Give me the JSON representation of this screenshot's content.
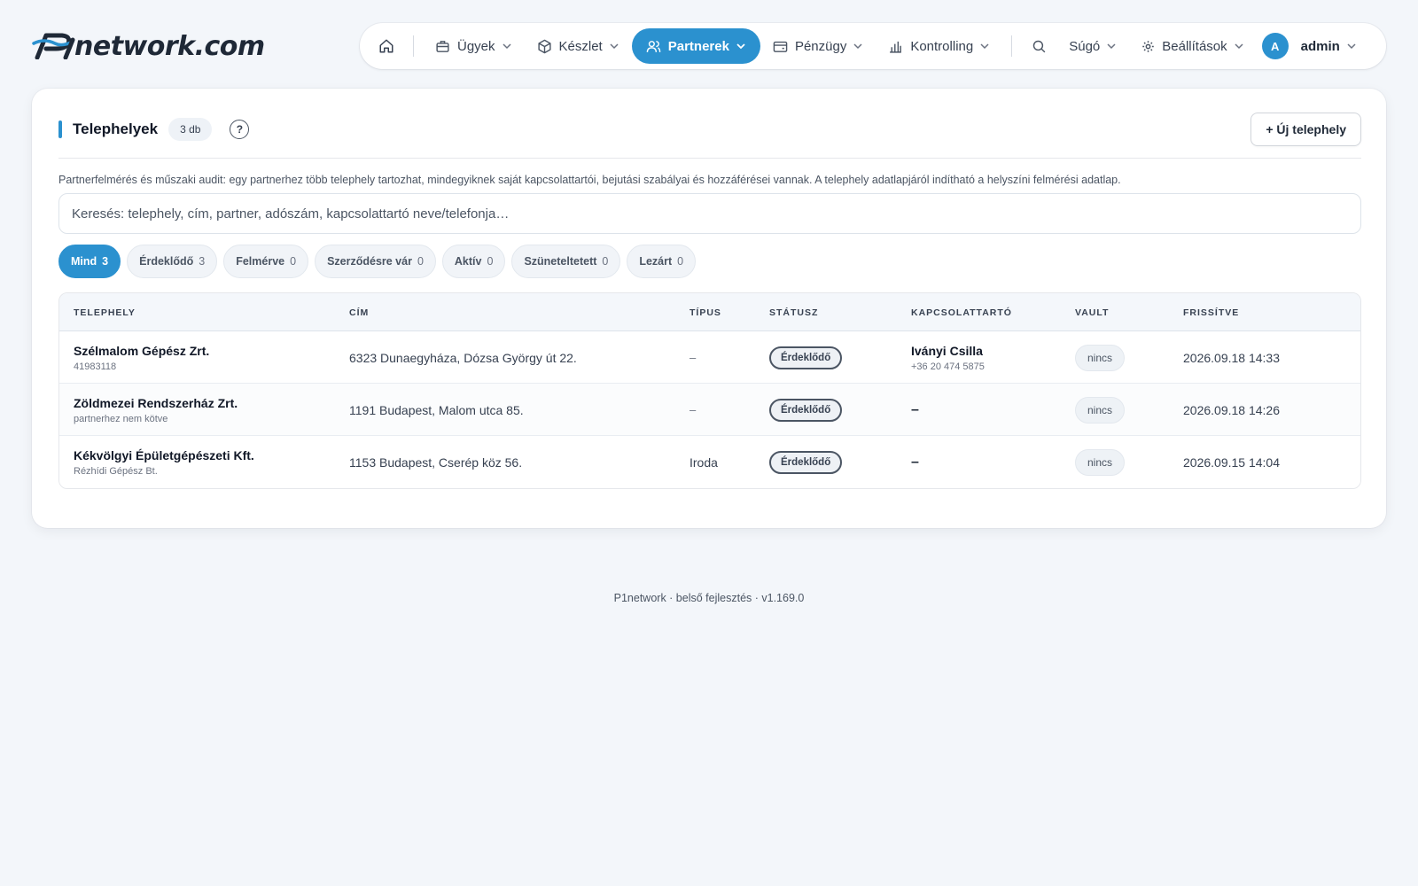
{
  "header": {
    "logo_text": "network.com",
    "nav": {
      "items": [
        {
          "label": "Ügyek"
        },
        {
          "label": "Készlet"
        },
        {
          "label": "Partnerek"
        },
        {
          "label": "Pénzügy"
        },
        {
          "label": "Kontrolling"
        }
      ],
      "help_label": "Súgó",
      "settings_label": "Beállítások",
      "avatar_initial": "A",
      "user_label": "admin"
    },
    "accent_color": "#2b91cf"
  },
  "page": {
    "title": "Telephelyek",
    "count_badge": "3 db",
    "help_button": "?",
    "new_button": "+ Új telephely",
    "description": "Partnerfelmérés és műszaki audit: egy partnerhez több telephely tartozhat, mindegyiknek saját kapcsolattartói, bejutási szabályai és hozzáférései vannak. A telephely adatlapjáról indítható a helyszíni felmérési adatlap.",
    "search_placeholder": "Keresés: telephely, cím, partner, adószám, kapcsolattartó neve/telefonja…",
    "filters": [
      {
        "label": "Mind",
        "count": "3"
      },
      {
        "label": "Érdeklődő",
        "count": "3"
      },
      {
        "label": "Felmérve",
        "count": "0"
      },
      {
        "label": "Szerződésre vár",
        "count": "0"
      },
      {
        "label": "Aktív",
        "count": "0"
      },
      {
        "label": "Szüneteltetett",
        "count": "0"
      },
      {
        "label": "Lezárt",
        "count": "0"
      }
    ],
    "table": {
      "columns": [
        "TELEPHELY",
        "CÍM",
        "TÍPUS",
        "STÁTUSZ",
        "KAPCSOLATTARTÓ",
        "VAULT",
        "FRISSÍTVE"
      ],
      "rows": [
        {
          "name": "Szélmalom Gépész Zrt.",
          "sub": "41983118",
          "address": "6323 Dunaegyháza, Dózsa György út 22.",
          "type": "–",
          "status": "Érdeklődő",
          "contact_name": "Iványi Csilla",
          "contact_phone": "+36 20 474 5875",
          "vault": "nincs",
          "updated": "2026.09.18 14:33"
        },
        {
          "name": "Zöldmezei Rendszerház Zrt.",
          "sub": "partnerhez nem kötve",
          "address": "1191 Budapest, Malom utca 85.",
          "type": "–",
          "status": "Érdeklődő",
          "contact_name": "–",
          "contact_phone": "",
          "vault": "nincs",
          "updated": "2026.09.18 14:26"
        },
        {
          "name": "Kékvölgyi Épületgépészeti Kft.",
          "sub": "Rézhídi Gépész Bt.",
          "address": "1153 Budapest, Cserép köz 56.",
          "type": "Iroda",
          "status": "Érdeklődő",
          "contact_name": "–",
          "contact_phone": "",
          "vault": "nincs",
          "updated": "2026.09.15 14:04"
        }
      ]
    }
  },
  "footer": {
    "text": "P1network · belső fejlesztés · v1.169.0"
  }
}
